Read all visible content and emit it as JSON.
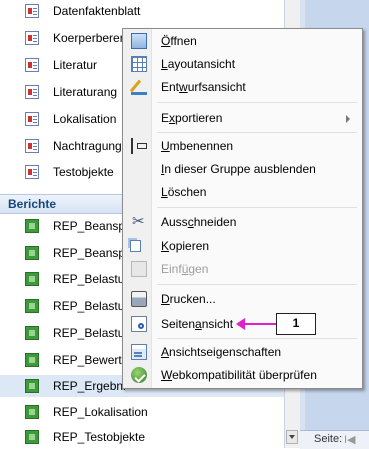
{
  "nav": {
    "forms": [
      {
        "label": "Datenfaktenblatt",
        "icon": "form-icon"
      },
      {
        "label": "Koerperberere",
        "icon": "form-icon"
      },
      {
        "label": "Literatur",
        "icon": "form-icon"
      },
      {
        "label": "Literaturang",
        "icon": "form-icon"
      },
      {
        "label": "Lokalisation",
        "icon": "form-icon"
      },
      {
        "label": "Nachtragung",
        "icon": "form-icon"
      },
      {
        "label": "Testobjekte",
        "icon": "form-icon"
      }
    ],
    "reports_group": "Berichte",
    "reports": [
      {
        "label": "REP_Beansp",
        "icon": "report-icon"
      },
      {
        "label": "REP_Beansp",
        "icon": "report-icon"
      },
      {
        "label": "REP_Belastu",
        "icon": "report-icon"
      },
      {
        "label": "REP_Belastu",
        "icon": "report-icon"
      },
      {
        "label": "REP_Belastu",
        "icon": "report-icon"
      },
      {
        "label": "REP_Bewertu",
        "icon": "report-icon"
      },
      {
        "label": "REP_Ergebni",
        "icon": "report-icon",
        "selected": true
      },
      {
        "label": "REP_Lokalisation",
        "icon": "report-icon"
      },
      {
        "label": "REP_Testobjekte",
        "icon": "report-icon"
      }
    ]
  },
  "context_menu": {
    "items": [
      {
        "pre": "",
        "key": "Ö",
        "post": "ffnen",
        "icon": "open-icon"
      },
      {
        "pre": "",
        "key": "L",
        "post": "ayoutansicht",
        "icon": "layout-view-icon"
      },
      {
        "pre": "Ent",
        "key": "w",
        "post": "urfsansicht",
        "icon": "design-view-icon"
      },
      {
        "pre": "E",
        "key": "x",
        "post": "portieren",
        "icon": "",
        "submenu": true
      },
      {
        "pre": "",
        "key": "U",
        "post": "mbenennen",
        "icon": "rename-icon"
      },
      {
        "pre": "",
        "key": "I",
        "post": "n dieser Gruppe ausblenden",
        "icon": ""
      },
      {
        "pre": "",
        "key": "L",
        "post": "öschen",
        "icon": ""
      },
      {
        "pre": "Auss",
        "key": "c",
        "post": "hneiden",
        "icon": "cut-icon"
      },
      {
        "pre": "",
        "key": "K",
        "post": "opieren",
        "icon": "copy-icon"
      },
      {
        "pre": "Einf",
        "key": "ü",
        "post": "gen",
        "icon": "paste-icon",
        "disabled": true
      },
      {
        "pre": "",
        "key": "D",
        "post": "rucken...",
        "icon": "print-icon"
      },
      {
        "pre": "Seiten",
        "key": "a",
        "post": "nsicht",
        "icon": "print-preview-icon"
      },
      {
        "pre": "",
        "key": "A",
        "post": "nsichtseigenschaften",
        "icon": "properties-icon"
      },
      {
        "pre": "",
        "key": "W",
        "post": "ebkompatibilität überprüfen",
        "icon": "web-check-icon"
      }
    ]
  },
  "callout": {
    "number": "1"
  },
  "status": {
    "page_label": "Seite:",
    "first_glyph": "I◀"
  }
}
